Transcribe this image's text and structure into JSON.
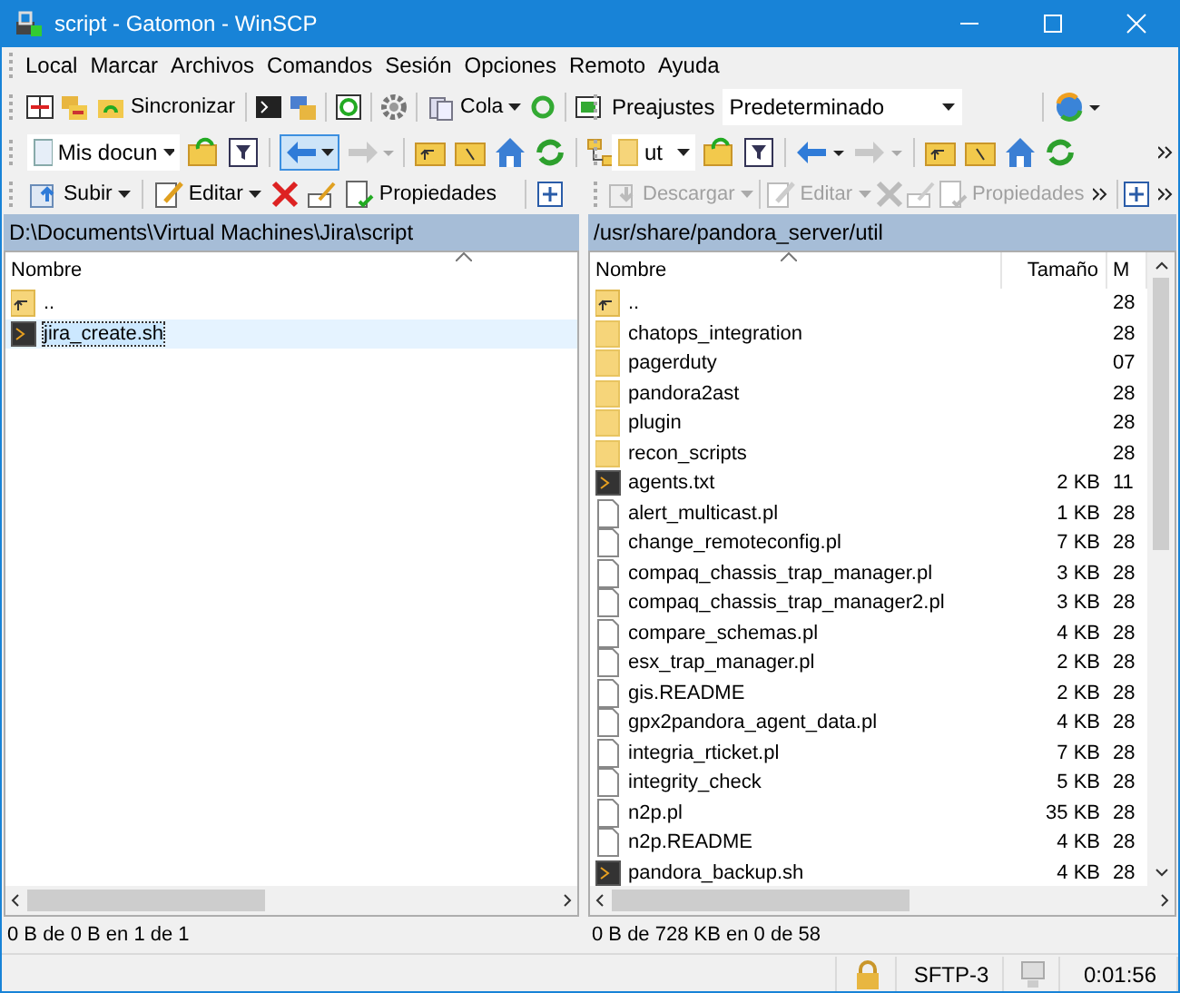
{
  "window": {
    "title": "script - Gatomon - WinSCP"
  },
  "menu": [
    "Local",
    "Marcar",
    "Archivos",
    "Comandos",
    "Sesión",
    "Opciones",
    "Remoto",
    "Ayuda"
  ],
  "toolbar": {
    "synchronize": "Sincronizar",
    "queue": "Cola",
    "presets_label": "Preajustes",
    "presets_value": "Predeterminado"
  },
  "local": {
    "location": "Mis docun",
    "back_hovered": true,
    "upload": "Subir",
    "edit": "Editar",
    "properties": "Propiedades",
    "path": "D:\\Documents\\Virtual Machines\\Jira\\script",
    "columns": [
      "Nombre"
    ],
    "rows": [
      {
        "name": "..",
        "kind": "parent",
        "selected": false
      },
      {
        "name": "jira_create.sh",
        "kind": "script",
        "selected": true
      }
    ],
    "status": "0 B de 0 B en 1 de 1"
  },
  "remote": {
    "location": "ut",
    "actions_disabled": true,
    "download": "Descargar",
    "edit": "Editar",
    "properties": "Propiedades",
    "path": "/usr/share/pandora_server/util",
    "columns": [
      "Nombre",
      "Tamaño",
      "M"
    ],
    "rows": [
      {
        "name": "..",
        "kind": "parent",
        "size": "",
        "date": "28",
        "selected": false
      },
      {
        "name": "chatops_integration",
        "kind": "folder",
        "size": "",
        "date": "28",
        "selected": false
      },
      {
        "name": "pagerduty",
        "kind": "folder",
        "size": "",
        "date": "07",
        "selected": false
      },
      {
        "name": "pandora2ast",
        "kind": "folder",
        "size": "",
        "date": "28",
        "selected": false
      },
      {
        "name": "plugin",
        "kind": "folder",
        "size": "",
        "date": "28",
        "selected": false
      },
      {
        "name": "recon_scripts",
        "kind": "folder",
        "size": "",
        "date": "28",
        "selected": false
      },
      {
        "name": "agents.txt",
        "kind": "script",
        "size": "2 KB",
        "date": "11",
        "selected": false
      },
      {
        "name": "alert_multicast.pl",
        "kind": "file",
        "size": "1 KB",
        "date": "28",
        "selected": false
      },
      {
        "name": "change_remoteconfig.pl",
        "kind": "file",
        "size": "7 KB",
        "date": "28",
        "selected": false
      },
      {
        "name": "compaq_chassis_trap_manager.pl",
        "kind": "file",
        "size": "3 KB",
        "date": "28",
        "selected": false
      },
      {
        "name": "compaq_chassis_trap_manager2.pl",
        "kind": "file",
        "size": "3 KB",
        "date": "28",
        "selected": false
      },
      {
        "name": "compare_schemas.pl",
        "kind": "file",
        "size": "4 KB",
        "date": "28",
        "selected": false
      },
      {
        "name": "esx_trap_manager.pl",
        "kind": "file",
        "size": "2 KB",
        "date": "28",
        "selected": false
      },
      {
        "name": "gis.README",
        "kind": "file",
        "size": "2 KB",
        "date": "28",
        "selected": false
      },
      {
        "name": "gpx2pandora_agent_data.pl",
        "kind": "file",
        "size": "4 KB",
        "date": "28",
        "selected": false
      },
      {
        "name": "integria_rticket.pl",
        "kind": "file",
        "size": "7 KB",
        "date": "28",
        "selected": false
      },
      {
        "name": "integrity_check",
        "kind": "file",
        "size": "5 KB",
        "date": "28",
        "selected": false
      },
      {
        "name": "n2p.pl",
        "kind": "file",
        "size": "35 KB",
        "date": "28",
        "selected": false
      },
      {
        "name": "n2p.README",
        "kind": "file",
        "size": "4 KB",
        "date": "28",
        "selected": false
      },
      {
        "name": "pandora_backup.sh",
        "kind": "script",
        "size": "4 KB",
        "date": "28",
        "selected": false
      }
    ],
    "status": "0 B de 728 KB en 0 de 58"
  },
  "status_bar": {
    "protocol": "SFTP-3",
    "elapsed": "0:01:56"
  }
}
